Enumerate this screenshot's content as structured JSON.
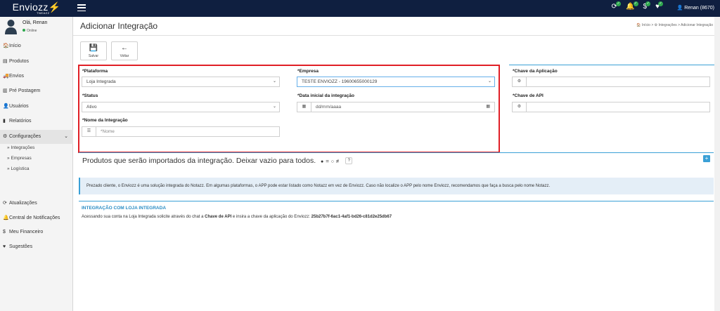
{
  "app": {
    "logo": "Enviozz",
    "logo_sub": "TNEAZZ"
  },
  "topbar": {
    "user_label": "Renan (8670)",
    "icons": [
      "sync-icon",
      "bell-icon",
      "dollar-icon",
      "heart-icon"
    ]
  },
  "sidebar": {
    "user_name": "Olá, Renan",
    "user_status": "Online",
    "items": [
      {
        "label": "Início",
        "icon": "home-icon"
      },
      {
        "label": "Produtos",
        "icon": "box-icon"
      },
      {
        "label": "Envios",
        "icon": "truck-icon"
      },
      {
        "label": "Pré Postagem",
        "icon": "barcode-icon"
      },
      {
        "label": "Usuários",
        "icon": "user-icon"
      },
      {
        "label": "Relatórios",
        "icon": "chart-icon"
      },
      {
        "label": "Configurações",
        "icon": "gear-icon"
      }
    ],
    "subitems": [
      "Integrações",
      "Empresas",
      "Logística"
    ],
    "bottom": [
      {
        "label": "Atualizações",
        "icon": "sync-icon"
      },
      {
        "label": "Central de Notificações",
        "icon": "bell-icon"
      },
      {
        "label": "Meu Financeiro",
        "icon": "dollar-icon"
      },
      {
        "label": "Sugestões",
        "icon": "heart-icon"
      }
    ]
  },
  "page": {
    "title": "Adicionar Integração",
    "breadcrumb": [
      "Início",
      "Integrações",
      "Adicionar Integração"
    ],
    "save_label": "Salvar",
    "back_label": "Voltar"
  },
  "form": {
    "platform_label": "*Plataforma",
    "platform_value": "Loja Integrada",
    "status_label": "*Status",
    "status_value": "Ativo",
    "name_label": "*Nome da Integração",
    "name_placeholder": "*Nome",
    "company_label": "*Empresa",
    "company_value": "TESTE ENVIOZZ - 19600655000129",
    "date_label": "*Data inicial da integração",
    "date_placeholder": "dd/mm/aaaa",
    "app_key_label": "*Chave da Aplicação",
    "api_key_label": "*Chave de API"
  },
  "products": {
    "title": "Produtos que serão importados da integração. Deixar vazio para todos.",
    "eq_symbol": "=",
    "neq_symbol": "≠"
  },
  "info": {
    "text": "Prezado cliente, o Enviozz é uma solução integrada do Notazz. Em algumas plataformas, o APP pode estar listado como Notazz em vez de Enviozz. Caso não localize o APP pelo nome Enviozz, recomendamos que faça a busca pelo nome Notazz."
  },
  "integration": {
    "title": "INTEGRAÇÃO COM LOJA INTEGRADA",
    "text_before": "Acessando sua conta na Loja Integrada solicite através do chat a",
    "key_name": "Chave de API",
    "text_mid": "e insira a chave da aplicação do Enviozz:",
    "app_key": "25b27b7f-6ac1-4af1-bd26-c81d2e25db67"
  },
  "colors": {
    "topbar": "#0f1f40",
    "accent": "#3aa0d6",
    "highlight": "#e01f26",
    "online": "#2fa84f"
  }
}
